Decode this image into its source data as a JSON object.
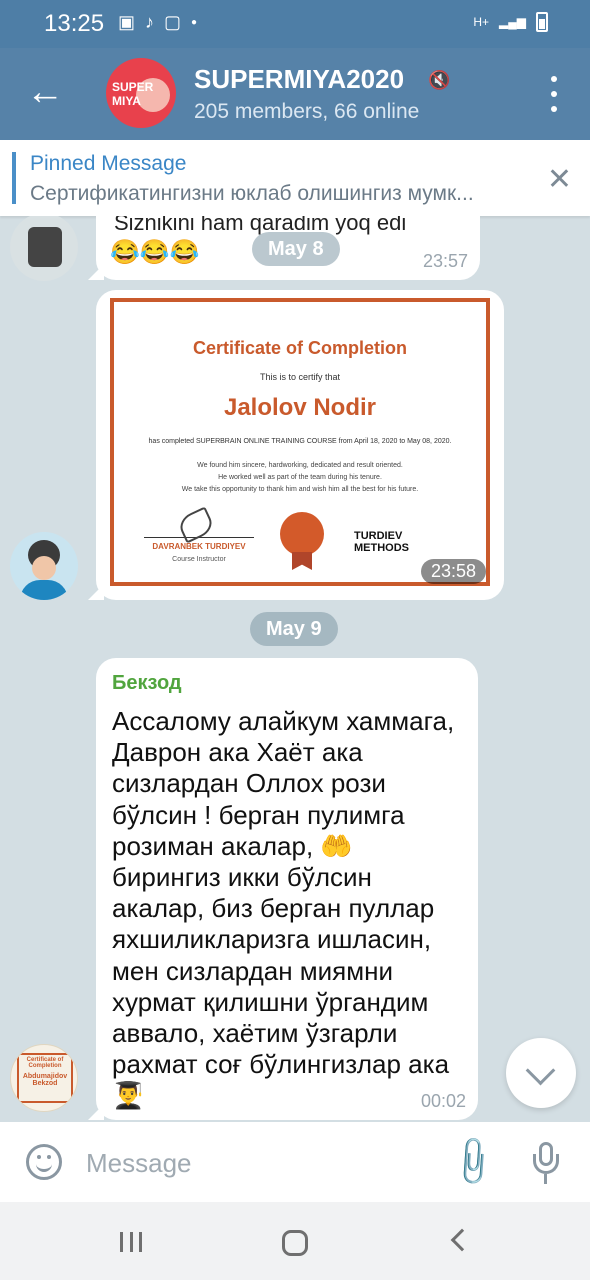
{
  "status_bar": {
    "time": "13:25",
    "network": "H+"
  },
  "header": {
    "back_icon": "arrow-left-icon",
    "avatar_text_1": "SUPER",
    "avatar_text_2": "MIYA",
    "title": "SUPERMIYA2020",
    "mute_icon": "muted-speaker-icon",
    "subtitle": "205 members, 66 online",
    "menu_icon": "more-vertical-icon"
  },
  "pinned": {
    "title": "Pinned Message",
    "text": "Сертификатингизни юклаб олишингиз мумк..."
  },
  "messages": {
    "m1_text": "Siznikini ham qaradim yoq edi",
    "m1_emoji": "😂😂😂",
    "m1_time": "23:57",
    "date1": "May 8",
    "photo_time": "23:58",
    "date2": "May 9",
    "m3_sender": "Бекзод",
    "m3_body": "Ассалому алайкум хаммага, Даврон ака Хаёт ака сизлардан Оллох рози бўлсин ! берган пулимга розиман акалар, 🤲 бирингиз икки бўлсин акалар, биз берган пуллар яхшиликларизга ишласин, мен сизлардан миямни хурмат қилишни ўргандим аввало, хаётим ўзгарли рахмат соғ бўлингизлар ака 👨‍🎓",
    "m3_time": "00:02"
  },
  "certificate": {
    "heading": "Certificate of Completion",
    "certify": "This is to certify that",
    "name": "Jalolov Nodir",
    "completed": "has completed SUPERBRAIN ONLINE TRAINING COURSE from April 18, 2020 to May 08, 2020.",
    "line1": "We found him sincere, hardworking, dedicated and result oriented.",
    "line2": "He worked well as part of the team during his tenure.",
    "line3": "We take this opportunity to thank him and wish him all the best for his future.",
    "signer": "DAVRANBEK TURDIYEV",
    "role": "Course Instructor",
    "logo_1": "TURDIEV",
    "logo_2": "METHODS"
  },
  "avatar3": {
    "title": "Certificate of Completion",
    "name": "Abdumajidov Bekzod"
  },
  "input": {
    "placeholder": "Message"
  }
}
